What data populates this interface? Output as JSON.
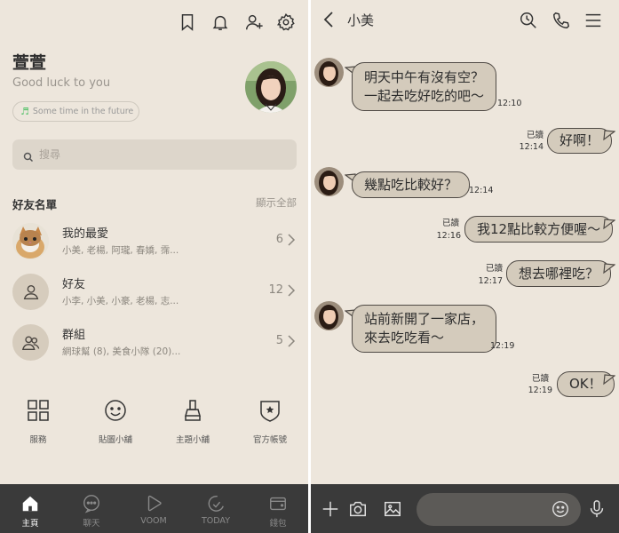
{
  "profile": {
    "name": "萱萱",
    "status": "Good luck to you",
    "music": "Some time in the future"
  },
  "search": {
    "placeholder": "搜尋"
  },
  "friends": {
    "title": "好友名單",
    "show_all": "顯示全部",
    "rows": [
      {
        "name": "我的最愛",
        "sub": "小美, 老楊, 阿瓏, 春嬌, 霈...",
        "count": "6"
      },
      {
        "name": "好友",
        "sub": "小李, 小美, 小豪, 老楊, 志...",
        "count": "12"
      },
      {
        "name": "群組",
        "sub": "網球幫 (8), 美食小隊 (20)...",
        "count": "5"
      }
    ]
  },
  "features": [
    {
      "label": "服務",
      "icon": "grid-icon"
    },
    {
      "label": "貼圖小舖",
      "icon": "smiley-icon"
    },
    {
      "label": "主題小舖",
      "icon": "brush-icon"
    },
    {
      "label": "官方帳號",
      "icon": "shield-star-icon"
    }
  ],
  "nav": [
    {
      "label": "主頁",
      "icon": "home-icon",
      "active": true
    },
    {
      "label": "聊天",
      "icon": "chat-icon",
      "active": false
    },
    {
      "label": "VOOM",
      "icon": "play-icon",
      "active": false
    },
    {
      "label": "TODAY",
      "icon": "today-icon",
      "active": false
    },
    {
      "label": "錢包",
      "icon": "wallet-icon",
      "active": false
    }
  ],
  "chat": {
    "title": "小美",
    "messages": [
      {
        "side": "in",
        "lines": [
          "明天中午有沒有空？",
          "一起去吃好吃的吧～"
        ],
        "time": "12:10"
      },
      {
        "side": "out",
        "lines": [
          "好啊！"
        ],
        "read": "已讀",
        "time": "12:14"
      },
      {
        "side": "in",
        "lines": [
          "幾點吃比較好？"
        ],
        "time": "12:14"
      },
      {
        "side": "out",
        "lines": [
          "我12點比較方便喔～"
        ],
        "read": "已讀",
        "time": "12:16"
      },
      {
        "side": "out",
        "lines": [
          "想去哪裡吃？"
        ],
        "read": "已讀",
        "time": "12:17"
      },
      {
        "side": "in",
        "lines": [
          "站前新開了一家店，",
          "來去吃吃看～"
        ],
        "time": "12:19"
      },
      {
        "side": "out",
        "lines": [
          "OK！"
        ],
        "read": "已讀",
        "time": "12:19"
      }
    ]
  },
  "colors": {
    "background": "#ede6dc",
    "bubble": "#d4cbbc",
    "bar": "#3a3a3a",
    "music_note": "#57c26b"
  }
}
